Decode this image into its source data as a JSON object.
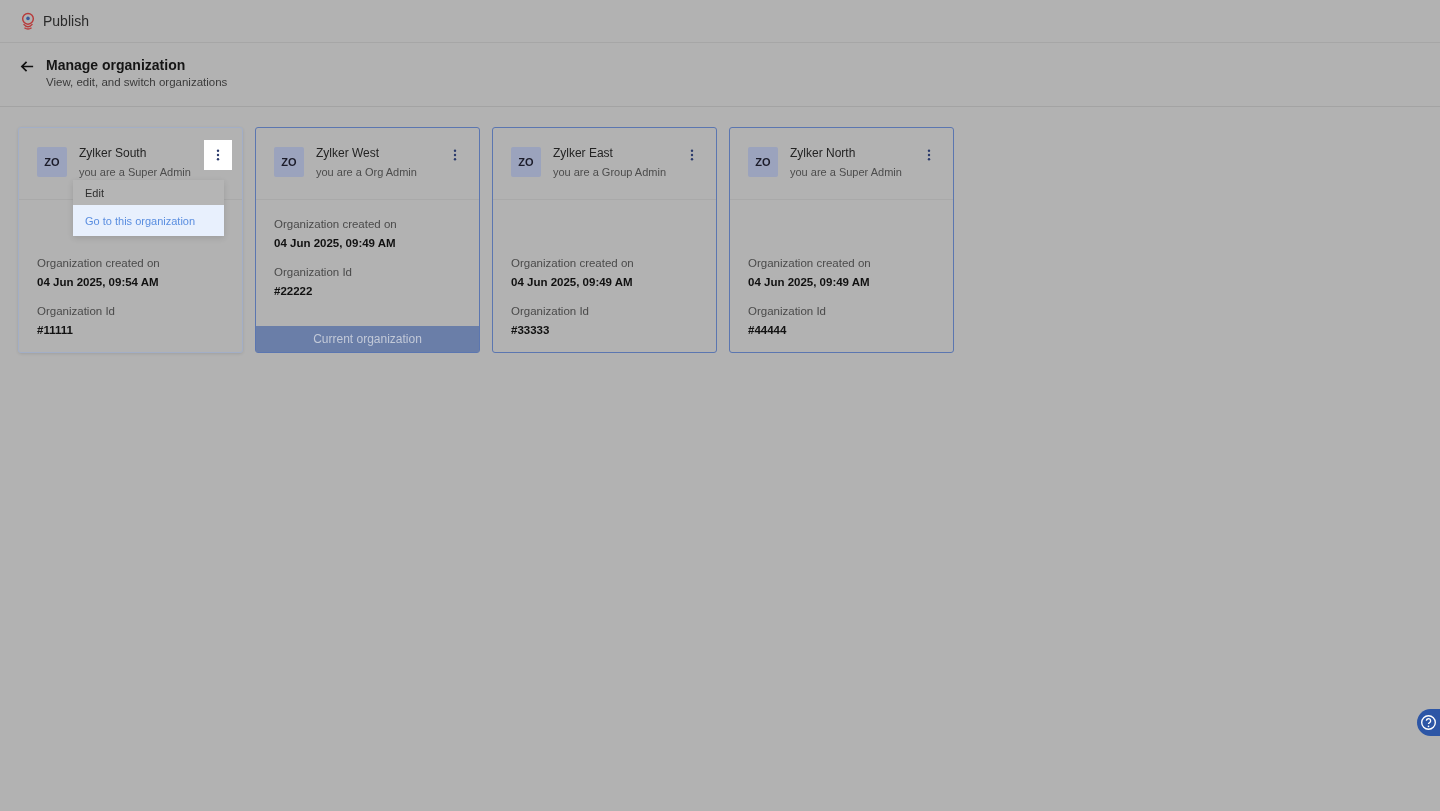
{
  "app": {
    "title": "Publish"
  },
  "header": {
    "title": "Manage organization",
    "subtitle": "View, edit, and switch organizations"
  },
  "organizations": [
    {
      "initials": "ZO",
      "name": "Zylker South",
      "role": "you are a Super Admin",
      "created_label": "Organization created on",
      "created": "04 Jun 2025, 09:54 AM",
      "id_label": "Organization Id",
      "id": "#11111",
      "current": false,
      "menu_open": true,
      "menu": [
        {
          "label": "Edit",
          "selected": false
        },
        {
          "label": "Go to this organization",
          "selected": true
        }
      ]
    },
    {
      "initials": "ZO",
      "name": "Zylker West",
      "role": "you are a Org Admin",
      "created_label": "Organization created on",
      "created": "04 Jun 2025, 09:49 AM",
      "id_label": "Organization Id",
      "id": "#22222",
      "current": true,
      "current_label": "Current organization",
      "menu_open": false
    },
    {
      "initials": "ZO",
      "name": "Zylker East",
      "role": "you are a Group Admin",
      "created_label": "Organization created on",
      "created": "04 Jun 2025, 09:49 AM",
      "id_label": "Organization Id",
      "id": "#33333",
      "current": false,
      "menu_open": false
    },
    {
      "initials": "ZO",
      "name": "Zylker North",
      "role": "you are a Super Admin",
      "created_label": "Organization created on",
      "created": "04 Jun 2025, 09:49 AM",
      "id_label": "Organization Id",
      "id": "#44444",
      "current": false,
      "menu_open": false
    }
  ]
}
